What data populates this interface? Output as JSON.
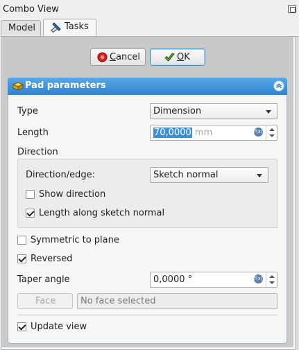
{
  "window": {
    "title": "Combo View"
  },
  "tabs": {
    "model": "Model",
    "tasks": "Tasks"
  },
  "buttons": {
    "cancel": "Cancel",
    "ok": "OK"
  },
  "panel": {
    "title": "Pad parameters"
  },
  "form": {
    "type_label": "Type",
    "type_value": "Dimension",
    "length_label": "Length",
    "length_value": "70,0000",
    "length_unit": "mm",
    "direction_label": "Direction",
    "direction_edge_label": "Direction/edge:",
    "direction_edge_value": "Sketch normal",
    "show_direction": "Show direction",
    "length_along_normal": "Length along sketch normal",
    "symmetric": "Symmetric to plane",
    "reversed": "Reversed",
    "taper_label": "Taper angle",
    "taper_value": "0,0000 °",
    "face_button": "Face",
    "face_field": "No face selected",
    "update_view": "Update view"
  },
  "checks": {
    "show_direction": false,
    "length_along_normal": true,
    "symmetric": false,
    "reversed": true,
    "update_view": true
  },
  "colors": {
    "header_blue": "#2d83cf",
    "selection_blue": "#3d8fd6",
    "cancel_red": "#d11d1d"
  },
  "icons": {
    "tasks": "pencil-ruler-icon",
    "cancel": "cancel-icon",
    "ok": "ok-check-icon",
    "pad": "pad-icon",
    "collapse": "collapse-icon",
    "expression": "expression-icon"
  }
}
